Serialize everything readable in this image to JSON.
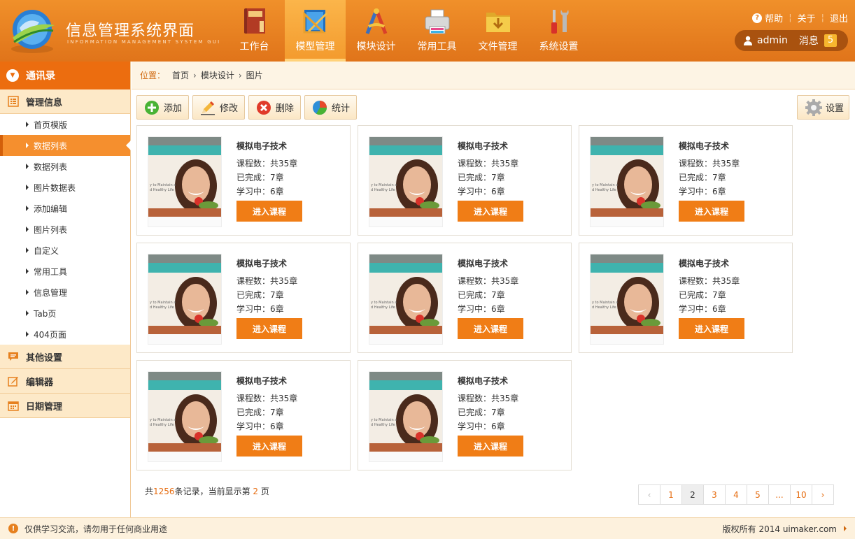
{
  "app": {
    "title": "信息管理系统界面",
    "subtitle": "INFORMATION MANAGEMENT SYSTEM GUI"
  },
  "nav": [
    {
      "label": "工作台",
      "icon": "book-icon"
    },
    {
      "label": "模型管理",
      "icon": "ruler-pencil-icon"
    },
    {
      "label": "模块设计",
      "icon": "drafting-compass-icon"
    },
    {
      "label": "常用工具",
      "icon": "printer-icon"
    },
    {
      "label": "文件管理",
      "icon": "folder-icon"
    },
    {
      "label": "系统设置",
      "icon": "tools-icon"
    }
  ],
  "top_links": {
    "help": "帮助",
    "about": "关于",
    "logout": "退出"
  },
  "user": {
    "name": "admin",
    "messages_label": "消息",
    "messages_count": "5"
  },
  "sidebar": {
    "header": "通讯录",
    "groups": [
      {
        "label": "管理信息",
        "icon": "list-icon"
      },
      {
        "label": "其他设置",
        "icon": "chat-icon"
      },
      {
        "label": "编辑器",
        "icon": "edit-icon"
      },
      {
        "label": "日期管理",
        "icon": "calendar-icon"
      }
    ],
    "items": [
      "首页模版",
      "数据列表",
      "数据列表",
      "图片数据表",
      "添加编辑",
      "图片列表",
      "自定义",
      "常用工具",
      "信息管理",
      "Tab页",
      "404页面"
    ],
    "active_index": 1
  },
  "breadcrumb": {
    "label": "位置：",
    "items": [
      "首页",
      "模块设计",
      "图片"
    ]
  },
  "toolbar": {
    "add": "添加",
    "edit": "修改",
    "delete": "删除",
    "stats": "统计",
    "settings": "设置"
  },
  "thumb_text": {
    "l1": "y to Maintain a",
    "l2": "d Healthy Life"
  },
  "cards": [
    {
      "title": "模拟电子技术",
      "courses": "课程数：共35章",
      "done": "已完成：7章",
      "learning": "学习中：6章",
      "button": "进入课程"
    },
    {
      "title": "模拟电子技术",
      "courses": "课程数：共35章",
      "done": "已完成：7章",
      "learning": "学习中：6章",
      "button": "进入课程"
    },
    {
      "title": "模拟电子技术",
      "courses": "课程数：共35章",
      "done": "已完成：7章",
      "learning": "学习中：6章",
      "button": "进入课程"
    },
    {
      "title": "模拟电子技术",
      "courses": "课程数：共35章",
      "done": "已完成：7章",
      "learning": "学习中：6章",
      "button": "进入课程"
    },
    {
      "title": "模拟电子技术",
      "courses": "课程数：共35章",
      "done": "已完成：7章",
      "learning": "学习中：6章",
      "button": "进入课程"
    },
    {
      "title": "模拟电子技术",
      "courses": "课程数：共35章",
      "done": "已完成：7章",
      "learning": "学习中：6章",
      "button": "进入课程"
    },
    {
      "title": "模拟电子技术",
      "courses": "课程数：共35章",
      "done": "已完成：7章",
      "learning": "学习中：6章",
      "button": "进入课程"
    },
    {
      "title": "模拟电子技术",
      "courses": "课程数：共35章",
      "done": "已完成：7章",
      "learning": "学习中：6章",
      "button": "进入课程"
    }
  ],
  "pagination": {
    "prefix": "共",
    "total": "1256",
    "mid": "条记录，当前显示第 ",
    "current": "2",
    "suffix": " 页",
    "pages": [
      "‹",
      "1",
      "2",
      "3",
      "4",
      "5",
      "...",
      "10",
      "›"
    ]
  },
  "footer": {
    "left": "仅供学习交流，请勿用于任何商业用途",
    "right": "版权所有 2014 uimaker.com"
  },
  "colors": {
    "brand": "#e6801e",
    "accent": "#f07d16",
    "sidebar_active": "#f58f2e"
  }
}
